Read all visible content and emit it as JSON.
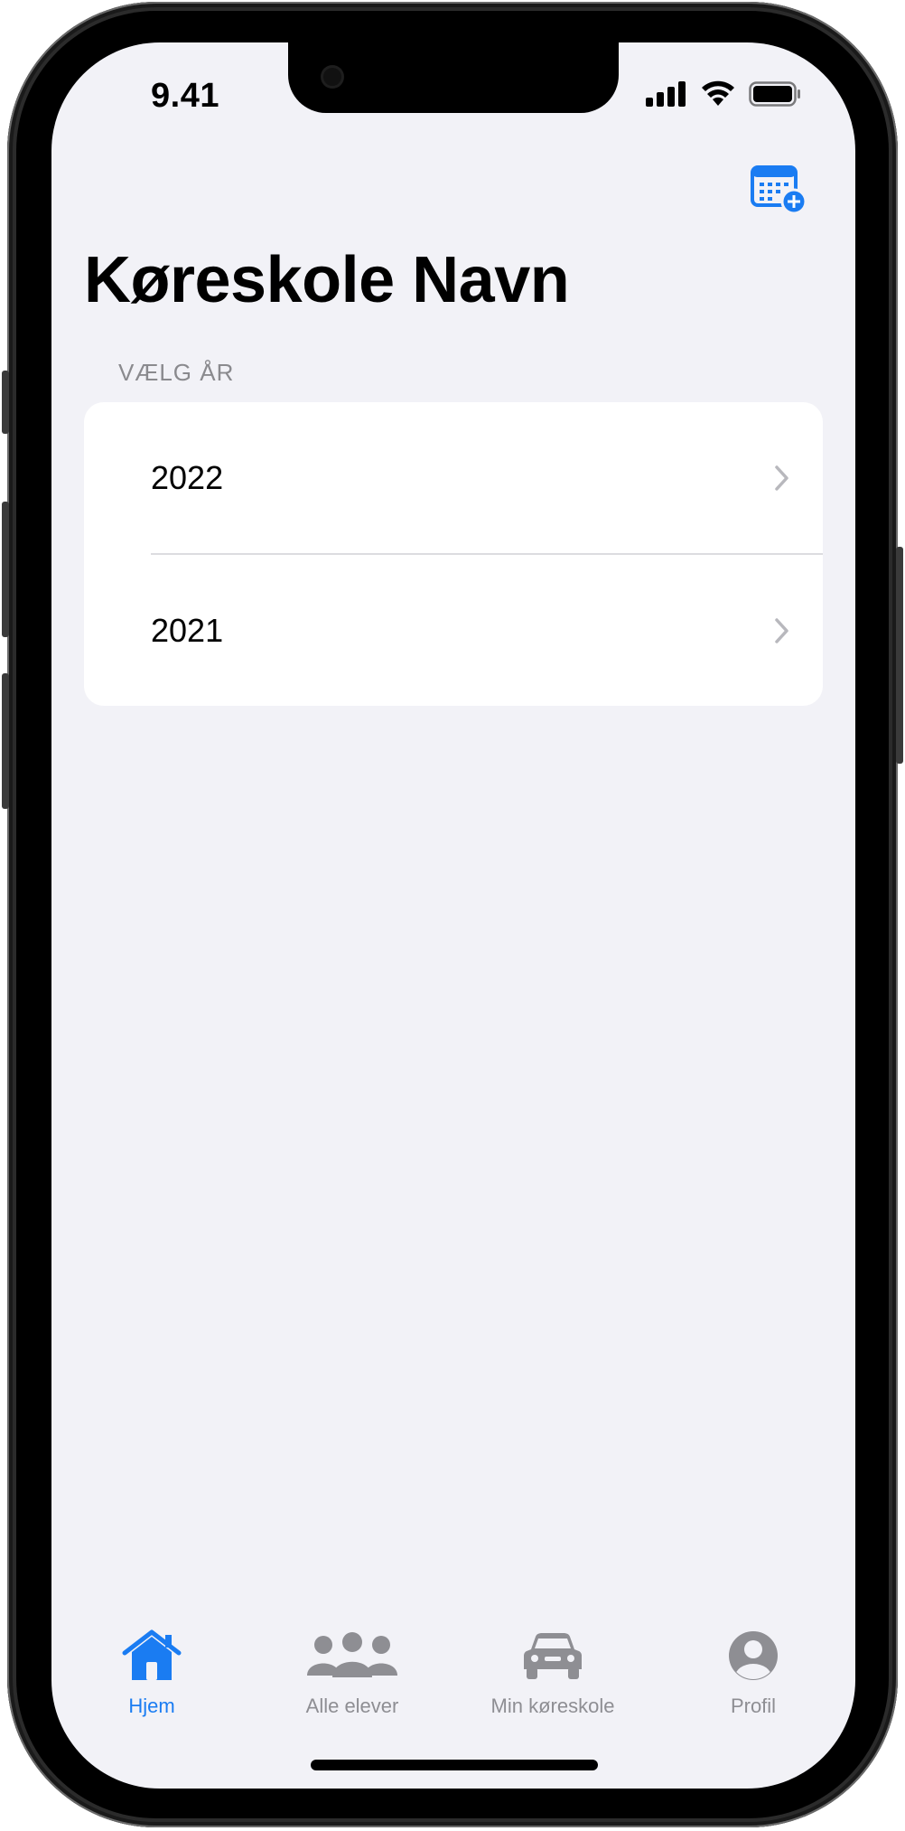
{
  "status_bar": {
    "time": "9.41"
  },
  "header": {
    "title": "Køreskole Navn",
    "calendar_add_icon": "calendar-plus-icon"
  },
  "section": {
    "label": "VÆLG ÅR"
  },
  "years": [
    {
      "label": "2022"
    },
    {
      "label": "2021"
    }
  ],
  "tabs": [
    {
      "label": "Hjem",
      "icon": "house-icon",
      "active": true
    },
    {
      "label": "Alle elever",
      "icon": "people-icon",
      "active": false
    },
    {
      "label": "Min køreskole",
      "icon": "car-icon",
      "active": false
    },
    {
      "label": "Profil",
      "icon": "person-icon",
      "active": false
    }
  ],
  "colors": {
    "accent": "#1a7cf2",
    "inactive": "#8e8e93",
    "background": "#f2f2f7"
  }
}
